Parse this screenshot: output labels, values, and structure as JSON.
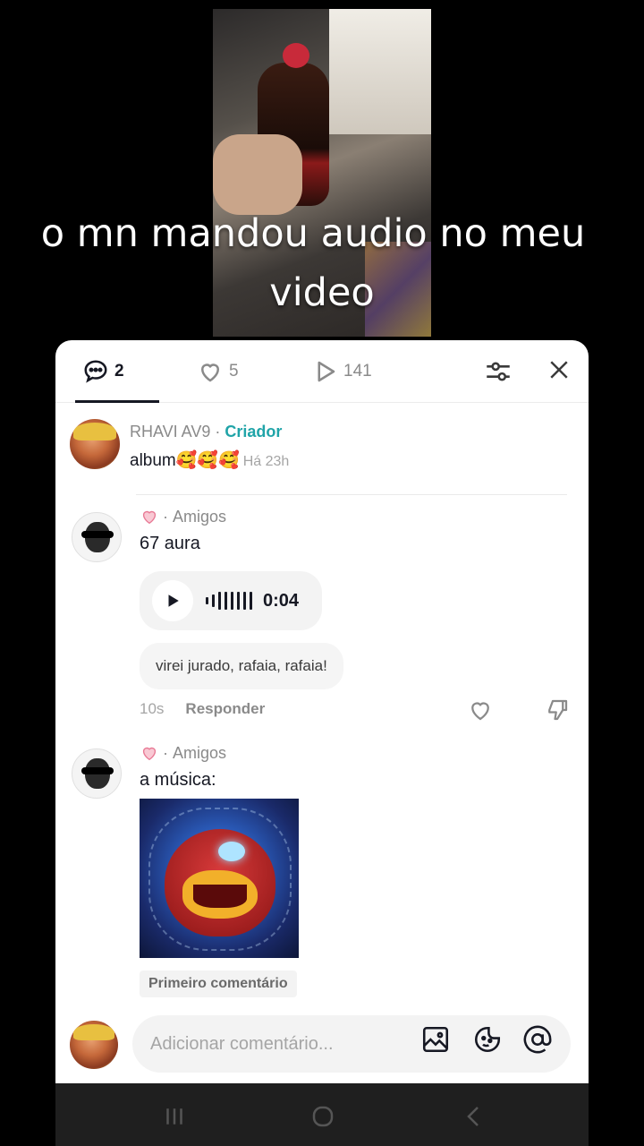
{
  "video": {
    "caption_line1": "o mn mandou audio no meu",
    "caption_line2": "video"
  },
  "tabs": [
    {
      "icon": "comment-bubble-icon",
      "count": "2"
    },
    {
      "icon": "heart-icon",
      "count": "5"
    },
    {
      "icon": "play-icon",
      "count": "141"
    }
  ],
  "creator_comment": {
    "username": "RHAVI AV9",
    "tag": "Criador",
    "text": "album🥰🥰🥰",
    "time": "Há 23h"
  },
  "comments": [
    {
      "relation": "Amigos",
      "text": "67 aura",
      "audio_duration": "0:04",
      "transcript": "virei jurado, rafaia, rafaia!",
      "time": "10s",
      "reply_label": "Responder"
    },
    {
      "relation": "Amigos",
      "text": "a música:",
      "badge": "Primeiro comentário"
    }
  ],
  "composer": {
    "placeholder": "Adicionar comentário..."
  },
  "colors": {
    "creator_tag": "#20a4a8",
    "text_primary": "#161823",
    "text_secondary": "#8a8a8a"
  }
}
